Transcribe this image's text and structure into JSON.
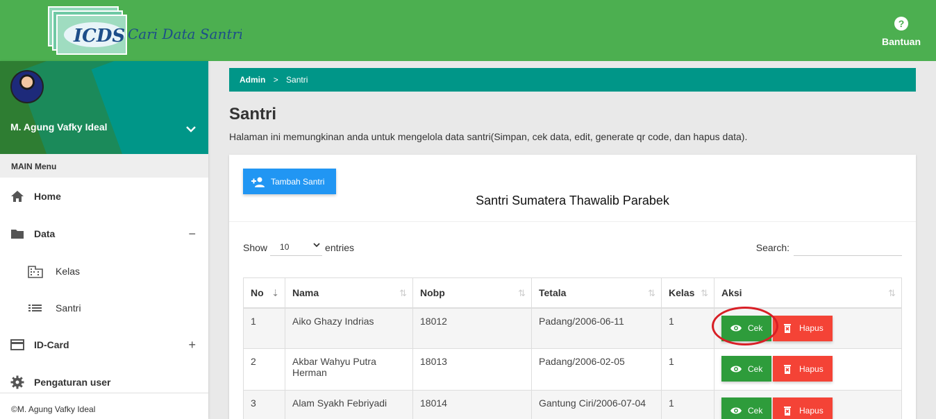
{
  "header": {
    "logo_text": "ICDS",
    "logo_tagline": "Cari Data Santri",
    "help_label": "Bantuan"
  },
  "sidebar": {
    "user_name": "M. Agung Vafky Ideal",
    "menu_header": "MAIN Menu",
    "items": [
      {
        "label": "Home",
        "icon": "home-icon"
      },
      {
        "label": "Data",
        "icon": "folder-icon",
        "toggle": "−"
      },
      {
        "label": "Kelas",
        "icon": "building-icon"
      },
      {
        "label": "Santri",
        "icon": "list-icon"
      },
      {
        "label": "ID-Card",
        "icon": "card-icon",
        "toggle": "+"
      },
      {
        "label": "Pengaturan user",
        "icon": "gear-icon"
      }
    ],
    "footer": "©M. Agung Vafky Ideal"
  },
  "breadcrumb": {
    "root": "Admin",
    "separator": ">",
    "current": "Santri"
  },
  "page": {
    "title": "Santri",
    "description": "Halaman ini memungkinan anda untuk mengelola data santri(Simpan, cek data, edit, generate qr code, dan hapus data)."
  },
  "card": {
    "add_button": "Tambah Santri",
    "title": "Santri Sumatera Thawalib Parabek",
    "show_label": "Show",
    "entries_value": "10",
    "entries_label": "entries",
    "search_label": "Search:"
  },
  "table": {
    "columns": [
      "No",
      "Nama",
      "Nobp",
      "Tetala",
      "Kelas",
      "Aksi"
    ],
    "rows": [
      {
        "no": "1",
        "nama": "Aiko Ghazy Indrias",
        "nobp": "18012",
        "tetala": "Padang/2006-06-11",
        "kelas": "1"
      },
      {
        "no": "2",
        "nama": "Akbar Wahyu Putra Herman",
        "nobp": "18013",
        "tetala": "Padang/2006-02-05",
        "kelas": "1"
      },
      {
        "no": "3",
        "nama": "Alam Syakh Febriyadi",
        "nobp": "18014",
        "tetala": "Gantung Ciri/2006-07-04",
        "kelas": "1"
      }
    ],
    "cek_label": "Cek",
    "hapus_label": "Hapus"
  },
  "colors": {
    "primary_green": "#4caf50",
    "teal": "#009688",
    "blue": "#2196f3",
    "red": "#f44336",
    "annotation": "#d81f26"
  }
}
